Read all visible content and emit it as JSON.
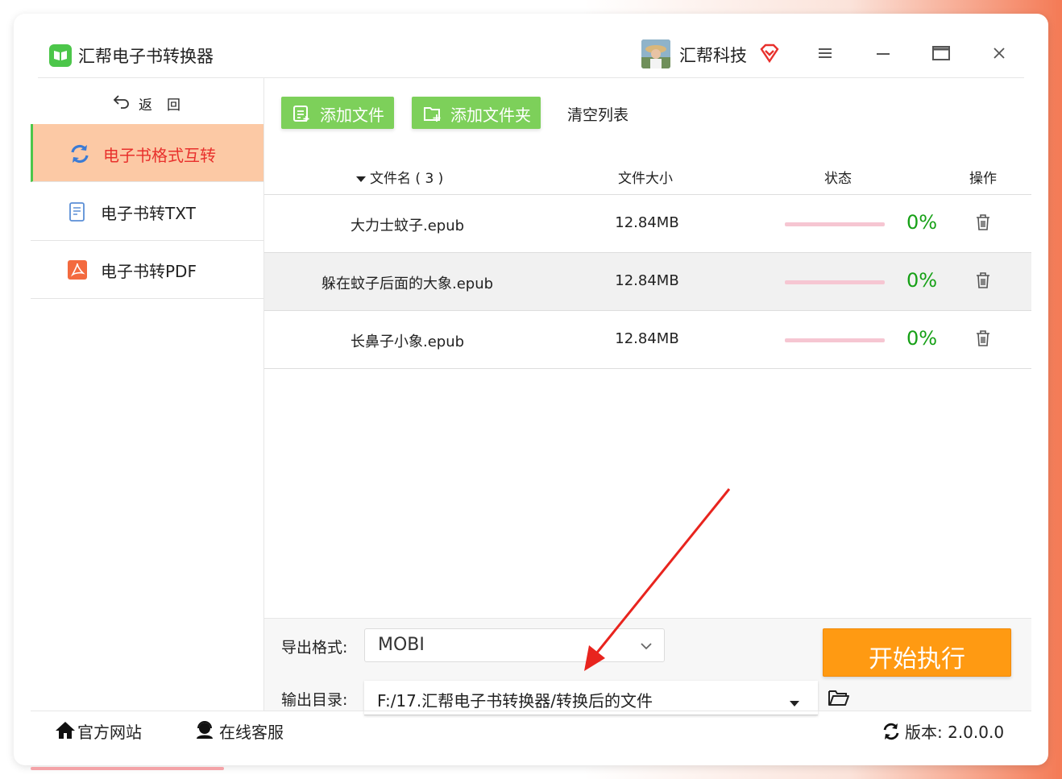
{
  "titlebar": {
    "app_title": "汇帮电子书转换器",
    "company_name": "汇帮科技",
    "accent_color": "#e8302c"
  },
  "sidebar": {
    "back_label": "返回",
    "items": [
      {
        "label": "电子书格式互转",
        "active": true,
        "icon": "refresh-icon"
      },
      {
        "label": "电子书转TXT",
        "active": false,
        "icon": "txt-file-icon"
      },
      {
        "label": "电子书转PDF",
        "active": false,
        "icon": "pdf-icon"
      }
    ]
  },
  "toolbar": {
    "add_file": "添加文件",
    "add_folder": "添加文件夹",
    "clear_list": "清空列表"
  },
  "table": {
    "headers": {
      "name": "文件名 ( 3 )",
      "size": "文件大小",
      "status": "状态",
      "action": "操作"
    },
    "rows": [
      {
        "name": "大力士蚊子.epub",
        "size": "12.84MB",
        "progress": "0%"
      },
      {
        "name": "躲在蚊子后面的大象.epub",
        "size": "12.84MB",
        "progress": "0%"
      },
      {
        "name": "长鼻子小象.epub",
        "size": "12.84MB",
        "progress": "0%"
      }
    ]
  },
  "settings": {
    "format_label": "导出格式:",
    "format_value": "MOBI",
    "output_label": "输出目录:",
    "output_value": "F:/17.汇帮电子书转换器/转换后的文件",
    "start_button": "开始执行"
  },
  "footer": {
    "website": "官方网站",
    "support": "在线客服",
    "version": "版本:  2.0.0.0"
  }
}
